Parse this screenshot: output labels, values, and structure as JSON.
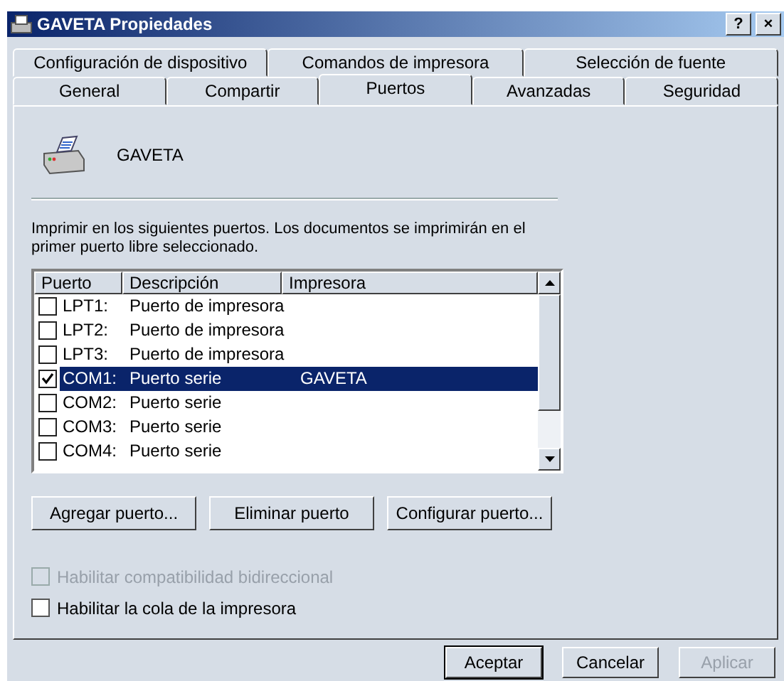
{
  "window": {
    "title": "GAVETA Propiedades",
    "help": "?",
    "close": "×"
  },
  "tab_rows": [
    [
      {
        "label": "Configuración de dispositivo",
        "selected": false
      },
      {
        "label": "Comandos de impresora",
        "selected": false
      },
      {
        "label": "Selección de fuente",
        "selected": false
      }
    ],
    [
      {
        "label": "General",
        "selected": false
      },
      {
        "label": "Compartir",
        "selected": false
      },
      {
        "label": "Puertos",
        "selected": true
      },
      {
        "label": "Avanzadas",
        "selected": false
      },
      {
        "label": "Seguridad",
        "selected": false
      }
    ]
  ],
  "printer_name": "GAVETA",
  "instructions": "Imprimir en los siguientes puertos. Los documentos se imprimirán en el primer puerto libre seleccionado.",
  "ports": {
    "columns": [
      "Puerto",
      "Descripción",
      "Impresora"
    ],
    "rows": [
      {
        "port": "LPT1:",
        "description": "Puerto de impresora",
        "printer": "",
        "checked": false,
        "selected": false
      },
      {
        "port": "LPT2:",
        "description": "Puerto de impresora",
        "printer": "",
        "checked": false,
        "selected": false
      },
      {
        "port": "LPT3:",
        "description": "Puerto de impresora",
        "printer": "",
        "checked": false,
        "selected": false
      },
      {
        "port": "COM1:",
        "description": "Puerto serie",
        "printer": "GAVETA",
        "checked": true,
        "selected": true
      },
      {
        "port": "COM2:",
        "description": "Puerto serie",
        "printer": "",
        "checked": false,
        "selected": false
      },
      {
        "port": "COM3:",
        "description": "Puerto serie",
        "printer": "",
        "checked": false,
        "selected": false
      },
      {
        "port": "COM4:",
        "description": "Puerto serie",
        "printer": "",
        "checked": false,
        "selected": false
      }
    ]
  },
  "port_buttons": [
    "Agregar puerto...",
    "Eliminar puerto",
    "Configurar puerto..."
  ],
  "options": [
    {
      "label": "Habilitar compatibilidad bidireccional",
      "checked": false,
      "disabled": true
    },
    {
      "label": "Habilitar la cola de la impresora",
      "checked": false,
      "disabled": false
    }
  ],
  "dialog_buttons": [
    {
      "label": "Aceptar",
      "default": true,
      "disabled": false
    },
    {
      "label": "Cancelar",
      "default": false,
      "disabled": false
    },
    {
      "label": "Aplicar",
      "default": false,
      "disabled": true
    }
  ]
}
